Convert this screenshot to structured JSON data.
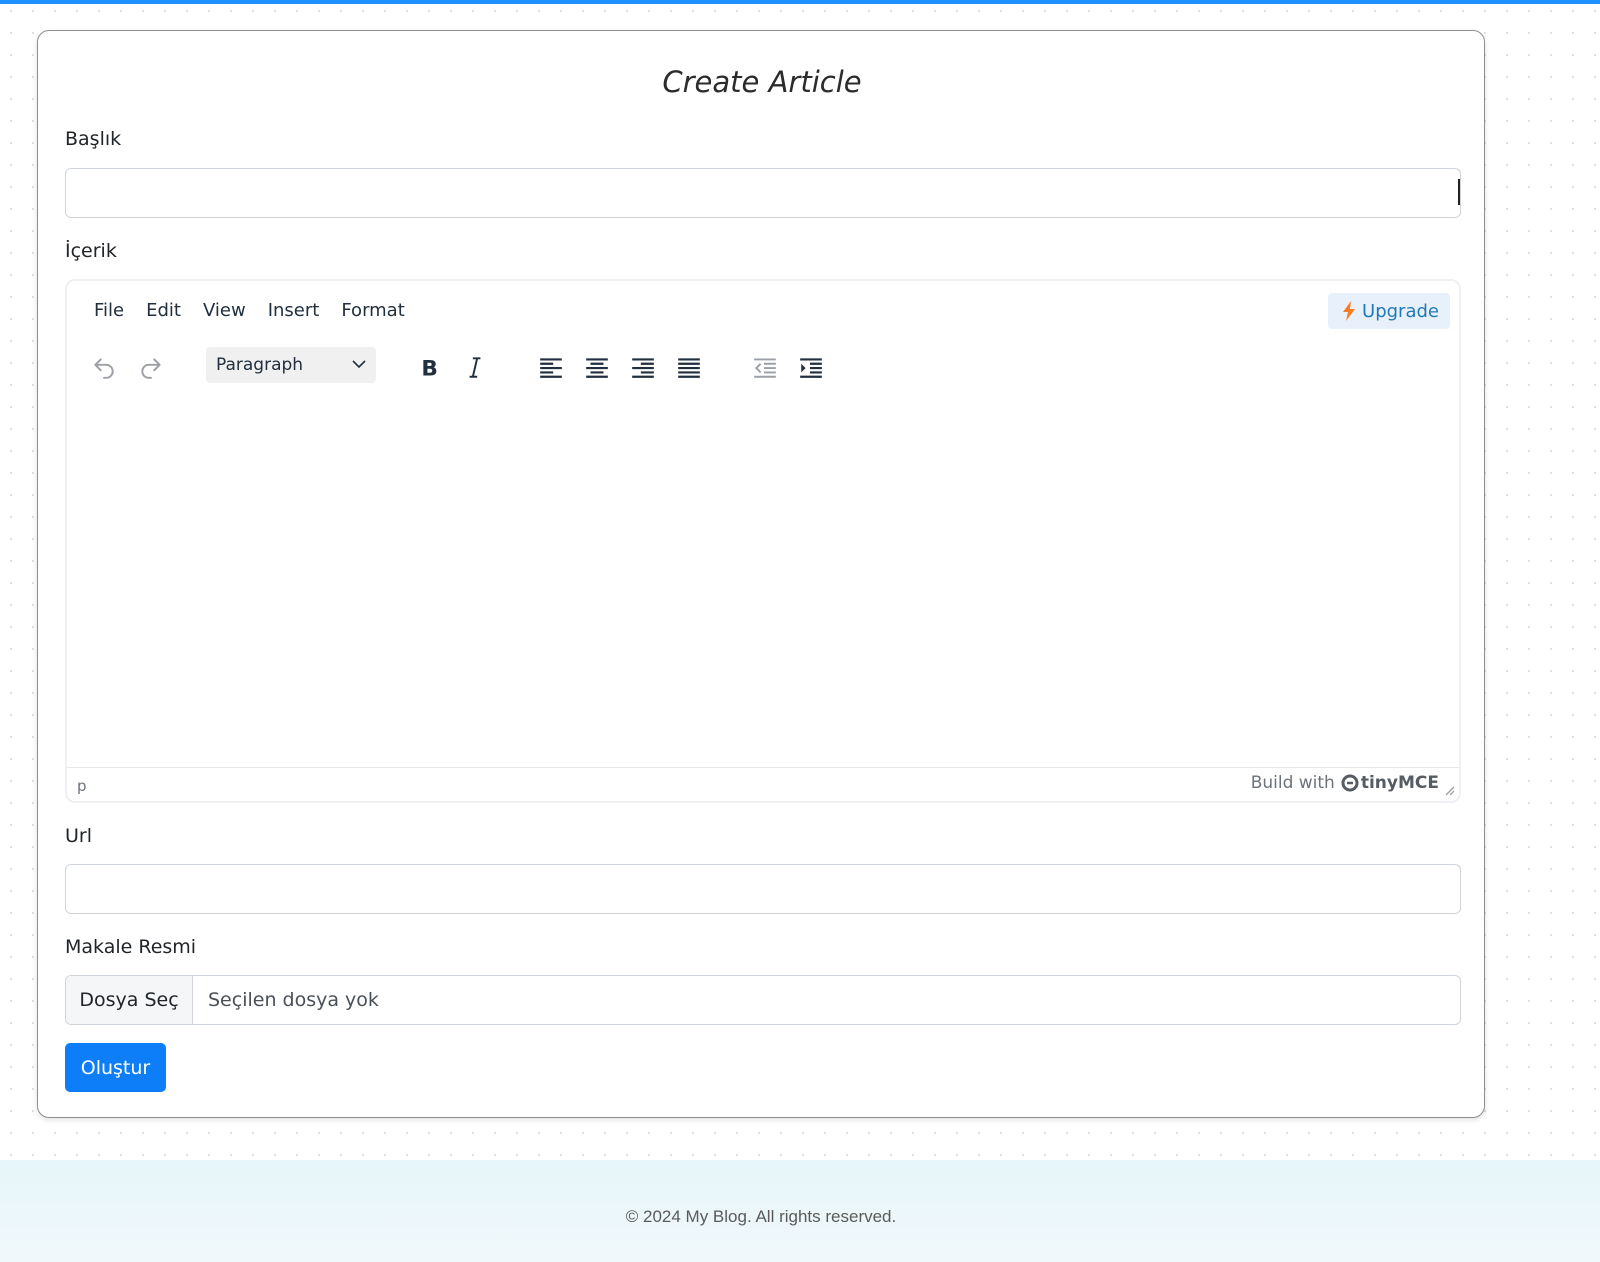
{
  "page": {
    "title": "Create Article"
  },
  "form": {
    "title_label": "Başlık",
    "title_value": "",
    "content_label": "İçerik",
    "url_label": "Url",
    "url_value": "",
    "image_label": "Makale Resmi",
    "file_button": "Dosya Seç",
    "file_status": "Seçilen dosya yok",
    "submit_label": "Oluştur"
  },
  "editor": {
    "menu": [
      "File",
      "Edit",
      "View",
      "Insert",
      "Format"
    ],
    "upgrade_label": "Upgrade",
    "block_format": "Paragraph",
    "toolbar_icons": [
      "undo-icon",
      "redo-icon",
      "bold-icon",
      "italic-icon",
      "align-left-icon",
      "align-center-icon",
      "align-right-icon",
      "align-justify-icon",
      "outdent-icon",
      "indent-icon"
    ],
    "status_path": "p",
    "branding_prefix": "Build with",
    "branding_name": "tinyMCE"
  },
  "footer": {
    "text": "© 2024 My Blog. All rights reserved."
  },
  "colors": {
    "accent": "#0d7ef8",
    "top_bar": "#1e90ff",
    "upgrade_text": "#207ab7",
    "upgrade_bolt": "#f77b22"
  }
}
